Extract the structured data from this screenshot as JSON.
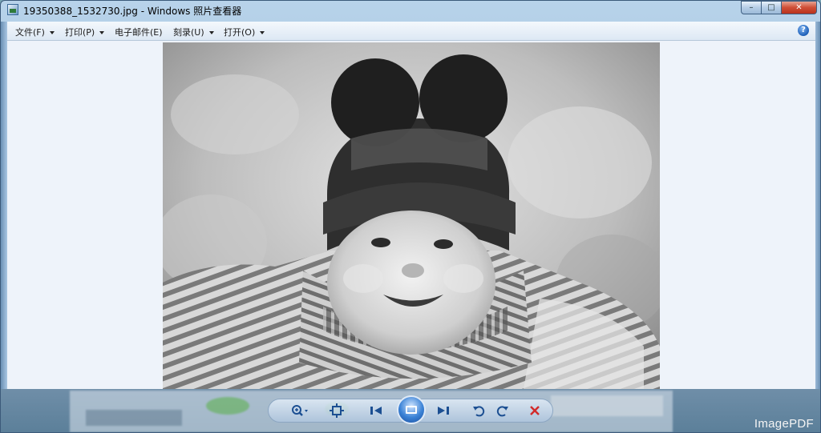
{
  "window": {
    "title": "19350388_1532730.jpg - Windows 照片查看器"
  },
  "menu": {
    "items": [
      {
        "label": "文件(F)",
        "has_dropdown": true
      },
      {
        "label": "打印(P)",
        "has_dropdown": true
      },
      {
        "label": "电子邮件(E)",
        "has_dropdown": false
      },
      {
        "label": "刻录(U)",
        "has_dropdown": true
      },
      {
        "label": "打开(O)",
        "has_dropdown": true
      }
    ],
    "help_icon": "help-icon",
    "help_glyph": "?"
  },
  "caption_buttons": {
    "minimize": "–",
    "maximize": "□",
    "close": "✕"
  },
  "toolbar": {
    "zoom_icon": "zoom-icon",
    "actual_size_icon": "actual-size-icon",
    "previous_icon": "previous-icon",
    "slideshow_icon": "slideshow-icon",
    "next_icon": "next-icon",
    "rotate_ccw_icon": "rotate-counterclockwise-icon",
    "rotate_cw_icon": "rotate-clockwise-icon",
    "delete_icon": "delete-icon"
  },
  "watermark": "ImagePDF",
  "colors": {
    "accent": "#1c4f92",
    "delete": "#d22b2b",
    "viewer_bg": "#eef3fa"
  }
}
